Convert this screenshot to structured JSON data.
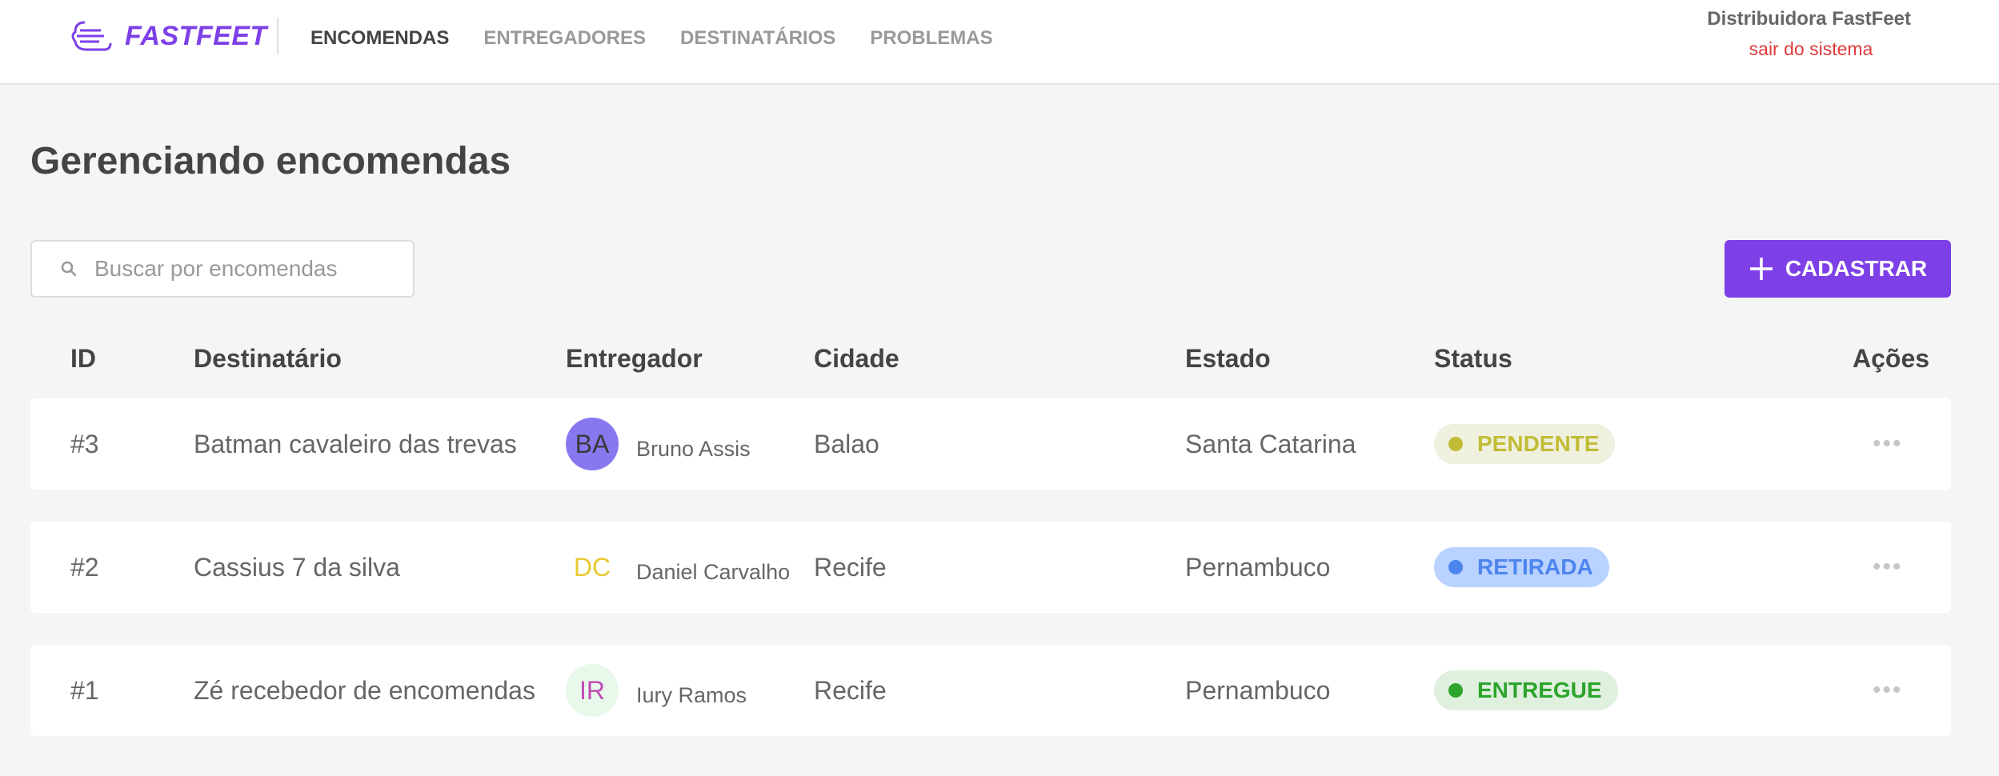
{
  "header": {
    "logo_text": "FASTFEET",
    "nav": [
      {
        "label": "ENCOMENDAS",
        "active": true
      },
      {
        "label": "ENTREGADORES",
        "active": false
      },
      {
        "label": "DESTINATÁRIOS",
        "active": false
      },
      {
        "label": "PROBLEMAS",
        "active": false
      }
    ],
    "profile_name": "Distribuidora FastFeet",
    "logout_label": "sair do sistema"
  },
  "page_title": "Gerenciando encomendas",
  "search": {
    "placeholder": "Buscar por encomendas",
    "value": ""
  },
  "add_button": {
    "label": "CADASTRAR",
    "icon": "plus-icon"
  },
  "table": {
    "columns": [
      "ID",
      "Destinatário",
      "Entregador",
      "Cidade",
      "Estado",
      "Status",
      "Ações"
    ],
    "rows": [
      {
        "id": "#3",
        "recipient": "Batman cavaleiro das trevas",
        "deliverer": {
          "initials": "BA",
          "name": "Bruno Assis",
          "avatar_bg": "#8878f0",
          "avatar_fg": "#3a3a3a"
        },
        "city": "Balao",
        "state": "Santa Catarina",
        "status": {
          "label": "PENDENTE",
          "bg": "#f0f0df",
          "fg": "#c1bc35"
        },
        "actions": "•••"
      },
      {
        "id": "#2",
        "recipient": "Cassius 7 da silva",
        "deliverer": {
          "initials": "DC",
          "name": "Daniel Carvalho",
          "avatar_bg": "#ffffff",
          "avatar_fg": "#e8c931"
        },
        "city": "Recife",
        "state": "Pernambuco",
        "status": {
          "label": "RETIRADA",
          "bg": "#bad2ff",
          "fg": "#4d85ee"
        },
        "actions": "•••"
      },
      {
        "id": "#1",
        "recipient": "Zé recebedor de encomendas",
        "deliverer": {
          "initials": "IR",
          "name": "Iury Ramos",
          "avatar_bg": "#e8f8ea",
          "avatar_fg": "#c04ab5"
        },
        "city": "Recife",
        "state": "Pernambuco",
        "status": {
          "label": "ENTREGUE",
          "bg": "#dff0df",
          "fg": "#2ca42b"
        },
        "actions": "•••"
      }
    ]
  },
  "colors": {
    "brand": "#7d40e7",
    "logout": "#de3b3b"
  }
}
